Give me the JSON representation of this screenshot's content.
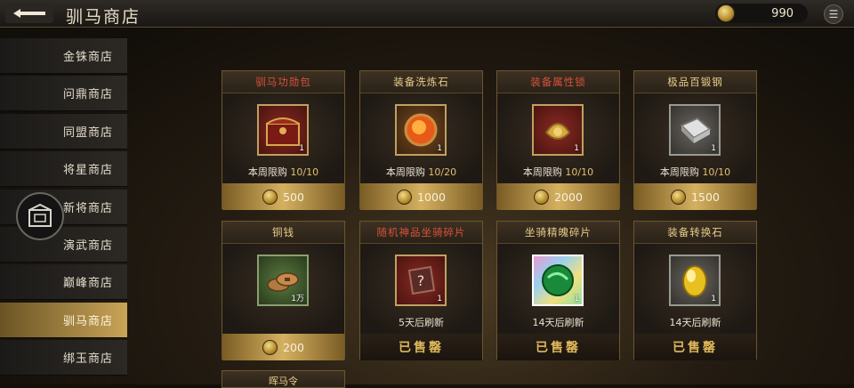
{
  "header": {
    "title": "驯马商店",
    "currency_value": "990"
  },
  "sidebar": {
    "items": [
      {
        "label": "金铢商店",
        "active": false
      },
      {
        "label": "问鼎商店",
        "active": false
      },
      {
        "label": "同盟商店",
        "active": false
      },
      {
        "label": "将星商店",
        "active": false
      },
      {
        "label": "新将商店",
        "active": false
      },
      {
        "label": "演武商店",
        "active": false
      },
      {
        "label": "巅峰商店",
        "active": false
      },
      {
        "label": "驯马商店",
        "active": true
      },
      {
        "label": "绑玉商店",
        "active": false
      }
    ]
  },
  "items": [
    {
      "name": "驯马功勋包",
      "quantity": "1",
      "limit_prefix": "本周限购",
      "limit_value": "10/10",
      "price": "500",
      "icon": "treasure-chest-icon"
    },
    {
      "name": "装备洗炼石",
      "quantity": "1",
      "limit_prefix": "本周限购",
      "limit_value": "10/20",
      "price": "1000",
      "icon": "fire-stone-icon"
    },
    {
      "name": "装备属性锁",
      "quantity": "1",
      "limit_prefix": "本周限购",
      "limit_value": "10/10",
      "price": "2000",
      "icon": "golden-lock-icon"
    },
    {
      "name": "极品百锻钢",
      "quantity": "1",
      "limit_prefix": "本周限购",
      "limit_value": "10/10",
      "price": "1500",
      "icon": "steel-ingot-icon"
    },
    {
      "name": "铜钱",
      "quantity": "1万",
      "refresh": "",
      "price": "200",
      "icon": "copper-coins-icon"
    },
    {
      "name": "随机神品坐骑碎片",
      "quantity": "1",
      "refresh": "5天后刷新",
      "status": "已售罄",
      "icon": "mystery-shard-icon"
    },
    {
      "name": "坐骑精魄碎片",
      "quantity": "1",
      "refresh": "14天后刷新",
      "status": "已售罄",
      "icon": "green-orb-icon"
    },
    {
      "name": "装备转换石",
      "quantity": "1",
      "refresh": "14天后刷新",
      "status": "已售罄",
      "icon": "gold-gem-icon"
    }
  ],
  "partial_card_label": "晖马令"
}
